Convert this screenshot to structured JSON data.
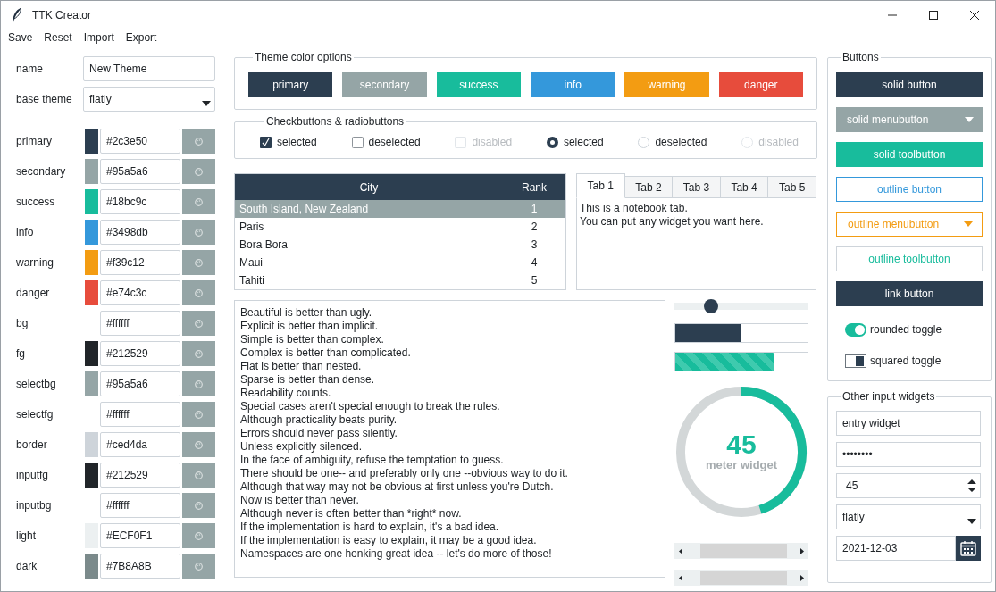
{
  "window": {
    "title": "TTK Creator"
  },
  "menu": [
    "Save",
    "Reset",
    "Import",
    "Export"
  ],
  "theme_form": {
    "name_label": "name",
    "name_value": "New Theme",
    "base_label": "base theme",
    "base_value": "flatly"
  },
  "colors": [
    {
      "label": "primary",
      "value": "#2c3e50",
      "color": "#2c3e50"
    },
    {
      "label": "secondary",
      "value": "#95a5a6",
      "color": "#95a5a6"
    },
    {
      "label": "success",
      "value": "#18bc9c",
      "color": "#18bc9c"
    },
    {
      "label": "info",
      "value": "#3498db",
      "color": "#3498db"
    },
    {
      "label": "warning",
      "value": "#f39c12",
      "color": "#f39c12"
    },
    {
      "label": "danger",
      "value": "#e74c3c",
      "color": "#e74c3c"
    },
    {
      "label": "bg",
      "value": "#ffffff"
    },
    {
      "label": "fg",
      "value": "#212529",
      "color": "#212529"
    },
    {
      "label": "selectbg",
      "value": "#95a5a6",
      "color": "#95a5a6"
    },
    {
      "label": "selectfg",
      "value": "#ffffff"
    },
    {
      "label": "border",
      "value": "#ced4da",
      "color": "#ced4da"
    },
    {
      "label": "inputfg",
      "value": "#212529",
      "color": "#212529"
    },
    {
      "label": "inputbg",
      "value": "#ffffff"
    },
    {
      "label": "light",
      "value": "#ECF0F1",
      "color": "#ecf0f1"
    },
    {
      "label": "dark",
      "value": "#7B8A8B",
      "color": "#7b8a8b"
    }
  ],
  "theme_color_options": {
    "title": "Theme color options",
    "buttons": [
      {
        "label": "primary",
        "color": "#2c3e50"
      },
      {
        "label": "secondary",
        "color": "#95a5a6"
      },
      {
        "label": "success",
        "color": "#18bc9c"
      },
      {
        "label": "info",
        "color": "#3498db"
      },
      {
        "label": "warning",
        "color": "#f39c12"
      },
      {
        "label": "danger",
        "color": "#e74c3c"
      }
    ]
  },
  "checks": {
    "title": "Checkbuttons & radiobuttons",
    "items": [
      {
        "kind": "checkbutton",
        "label": "selected",
        "checked": true,
        "disabled": false
      },
      {
        "kind": "checkbutton",
        "label": "deselected",
        "checked": false,
        "disabled": false
      },
      {
        "kind": "checkbutton",
        "label": "disabled",
        "checked": false,
        "disabled": true
      },
      {
        "kind": "radiobutton",
        "label": "selected",
        "checked": true,
        "disabled": false
      },
      {
        "kind": "radiobutton",
        "label": "deselected",
        "checked": false,
        "disabled": false
      },
      {
        "kind": "radiobutton",
        "label": "disabled",
        "checked": false,
        "disabled": true
      }
    ]
  },
  "table": {
    "columns": [
      "City",
      "Rank"
    ],
    "rows": [
      {
        "cells": [
          "South Island, New Zealand",
          "1"
        ],
        "selected": true
      },
      {
        "cells": [
          "Paris",
          "2"
        ],
        "selected": false
      },
      {
        "cells": [
          "Bora Bora",
          "3"
        ],
        "selected": false
      },
      {
        "cells": [
          "Maui",
          "4"
        ],
        "selected": false
      },
      {
        "cells": [
          "Tahiti",
          "5"
        ],
        "selected": false
      }
    ]
  },
  "notebook": {
    "tabs": [
      {
        "label": "Tab 1",
        "selected": true
      },
      {
        "label": "Tab 2",
        "selected": false
      },
      {
        "label": "Tab 3",
        "selected": false
      },
      {
        "label": "Tab 4",
        "selected": false
      },
      {
        "label": "Tab 5",
        "selected": false
      }
    ],
    "content": [
      "This is a notebook tab.",
      "You can put any widget you want here."
    ]
  },
  "text_lines": [
    "Beautiful is better than ugly.",
    "Explicit is better than implicit.",
    "Simple is better than complex.",
    "Complex is better than complicated.",
    "Flat is better than nested.",
    "Sparse is better than dense.",
    "Readability counts.",
    "Special cases aren't special enough to break the rules.",
    "Although practicality beats purity.",
    "Errors should never pass silently.",
    "Unless explicitly silenced.",
    "In the face of ambiguity, refuse the temptation to guess.",
    "There should be one-- and preferably only one --obvious way to do it.",
    "Although that way may not be obvious at first unless you're Dutch.",
    "Now is better than never.",
    "Although never is often better than *right* now.",
    "If the implementation is hard to explain, it's a bad idea.",
    "If the implementation is easy to explain, it may be a good idea.",
    "Namespaces are one honking great idea -- let's do more of those!"
  ],
  "slider": {
    "level": 0.27
  },
  "progress": {
    "level": 0.5
  },
  "striped_progress": {
    "level": 0.75
  },
  "meter": {
    "level": 0.45,
    "value": "45",
    "label": "meter widget"
  },
  "buttons_panel": {
    "title": "Buttons",
    "buttons": [
      {
        "kind": "solid",
        "label": "solid button",
        "color": "#2c3e50"
      },
      {
        "kind": "solid-menu",
        "label": "solid menubutton",
        "color": "#95a5a6"
      },
      {
        "kind": "solid",
        "label": "solid toolbutton",
        "color": "#18bc9c"
      },
      {
        "kind": "outline",
        "label": "outline button",
        "color": "#3498db"
      },
      {
        "kind": "outline-menu",
        "label": "outline menubutton",
        "color": "#f39c12"
      },
      {
        "kind": "outline-plain",
        "label": "outline toolbutton",
        "color": "#18bc9c"
      },
      {
        "kind": "solid",
        "label": "link button",
        "color": "#2c3e50"
      }
    ],
    "toggles": [
      {
        "kind": "round",
        "label": "rounded toggle",
        "on": true
      },
      {
        "kind": "square",
        "label": "squared toggle",
        "on": true
      }
    ]
  },
  "other_inputs": {
    "title": "Other input widgets",
    "entry": "entry widget",
    "password": "••••••••",
    "spinbox": "45",
    "combobox": "flatly",
    "date": "2021-12-03"
  }
}
